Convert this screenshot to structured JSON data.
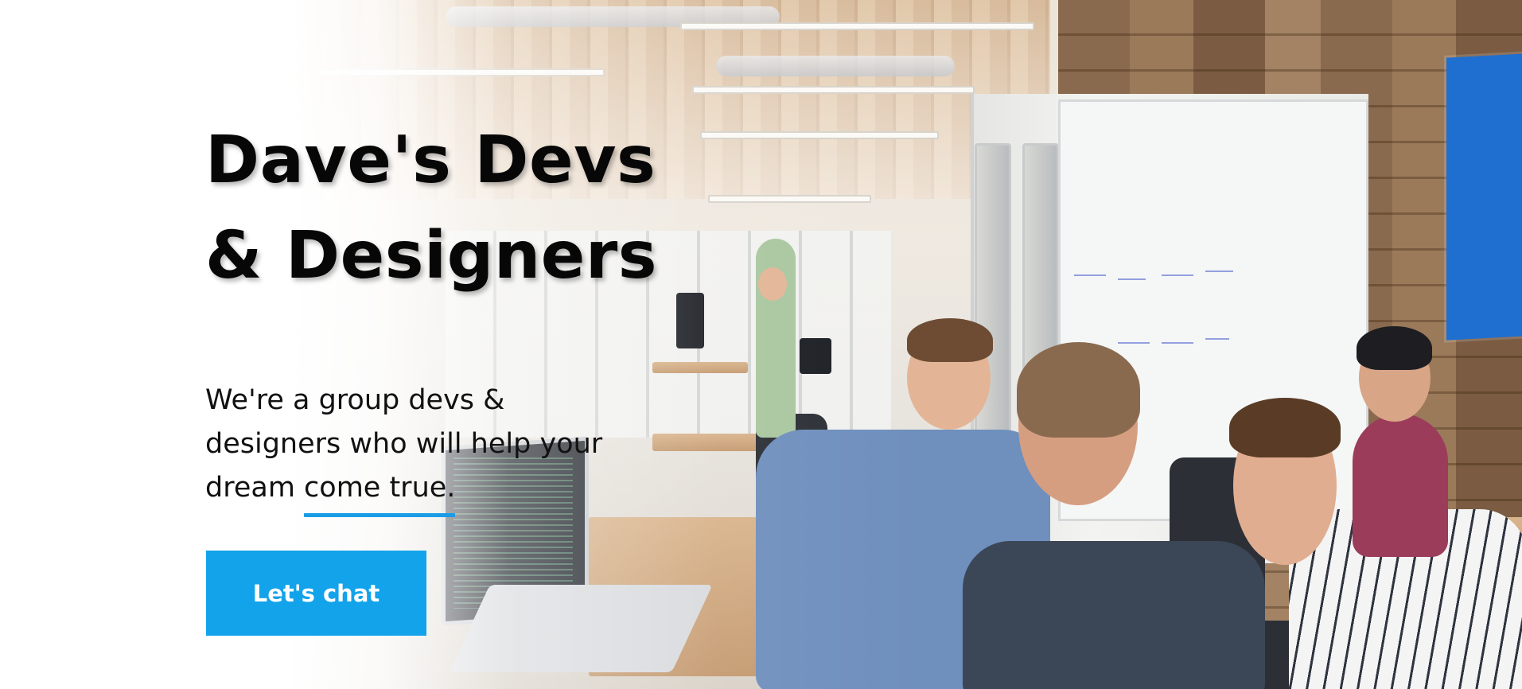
{
  "hero": {
    "title_line1": "Dave's Devs",
    "title_line2": "& Designers",
    "subtitle_line1": "We're a group devs &",
    "subtitle_line2": "designers who will help your",
    "subtitle_line3_before": "dream ",
    "subtitle_highlight": "come true.",
    "cta_label": "Let's chat",
    "accent_color": "#12a3ea"
  }
}
